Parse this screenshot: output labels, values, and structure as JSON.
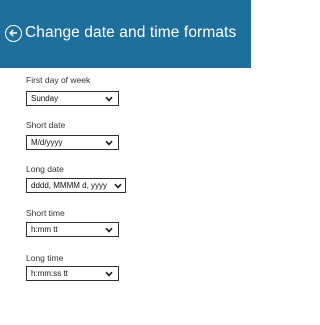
{
  "header": {
    "title": "Change date and time formats",
    "back_icon": "back-arrow-circle-icon",
    "background_color": "#1f6f9c"
  },
  "fields": [
    {
      "label": "First day of week",
      "value": "Sunday"
    },
    {
      "label": "Short date",
      "value": "M/d/yyyy"
    },
    {
      "label": "Long date",
      "value": "dddd, MMMM d, yyyy"
    },
    {
      "label": "Short time",
      "value": "h:mm tt"
    },
    {
      "label": "Long time",
      "value": "h:mm:ss tt"
    }
  ]
}
